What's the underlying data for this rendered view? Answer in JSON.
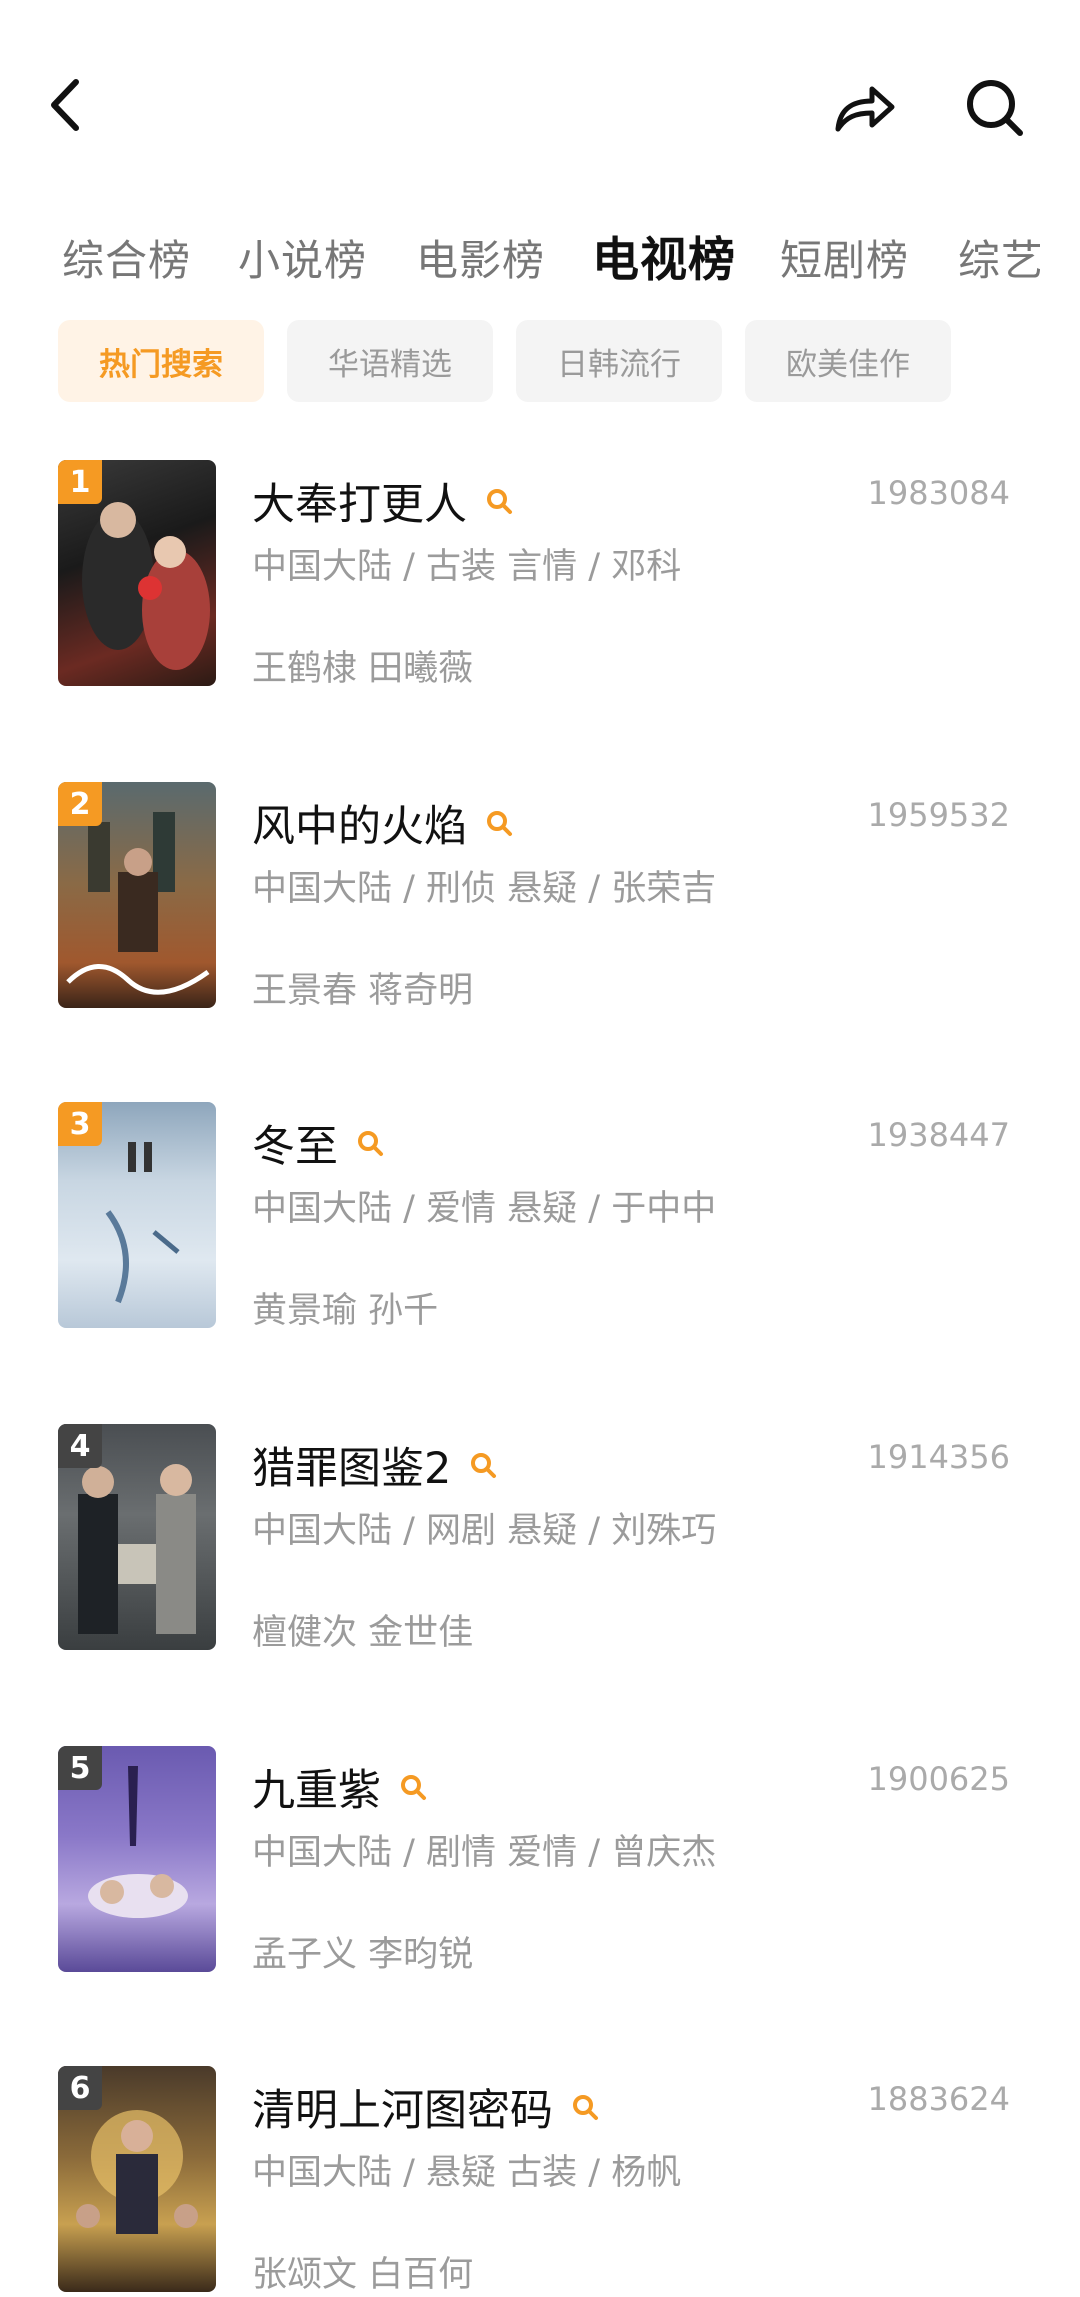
{
  "header": {
    "back_icon": "chevron-left-icon",
    "share_icon": "share-arrow-icon",
    "search_icon": "search-icon"
  },
  "category_tabs": [
    {
      "label": "综合榜",
      "active": false
    },
    {
      "label": "小说榜",
      "active": false
    },
    {
      "label": "电影榜",
      "active": false
    },
    {
      "label": "电视榜",
      "active": true
    },
    {
      "label": "短剧榜",
      "active": false
    },
    {
      "label": "综艺",
      "active": false
    }
  ],
  "filter_chips": [
    {
      "label": "热门搜索",
      "active": true
    },
    {
      "label": "华语精选",
      "active": false
    },
    {
      "label": "日韩流行",
      "active": false
    },
    {
      "label": "欧美佳作",
      "active": false
    }
  ],
  "colors": {
    "accent": "#f59a23",
    "rank_badge": "#f59a23",
    "rank_badge_muted": "#444444"
  },
  "items": [
    {
      "rank": "1",
      "title": "大奉打更人",
      "count": "1983084",
      "meta": "中国大陆 / 古装 言情 / 邓科",
      "cast": "王鹤棣 田曦薇"
    },
    {
      "rank": "2",
      "title": "风中的火焰",
      "count": "1959532",
      "meta": "中国大陆 / 刑侦 悬疑 / 张荣吉",
      "cast": "王景春 蒋奇明"
    },
    {
      "rank": "3",
      "title": "冬至",
      "count": "1938447",
      "meta": "中国大陆 / 爱情 悬疑 / 于中中",
      "cast": "黄景瑜 孙千"
    },
    {
      "rank": "4",
      "title": "猎罪图鉴2",
      "count": "1914356",
      "meta": "中国大陆 / 网剧 悬疑 / 刘殊巧",
      "cast": "檀健次 金世佳"
    },
    {
      "rank": "5",
      "title": "九重紫",
      "count": "1900625",
      "meta": "中国大陆 / 剧情 爱情 / 曾庆杰",
      "cast": "孟子义 李昀锐"
    },
    {
      "rank": "6",
      "title": "清明上河图密码",
      "count": "1883624",
      "meta": "中国大陆 / 悬疑 古装 / 杨帆",
      "cast": "张颂文 白百何"
    }
  ]
}
